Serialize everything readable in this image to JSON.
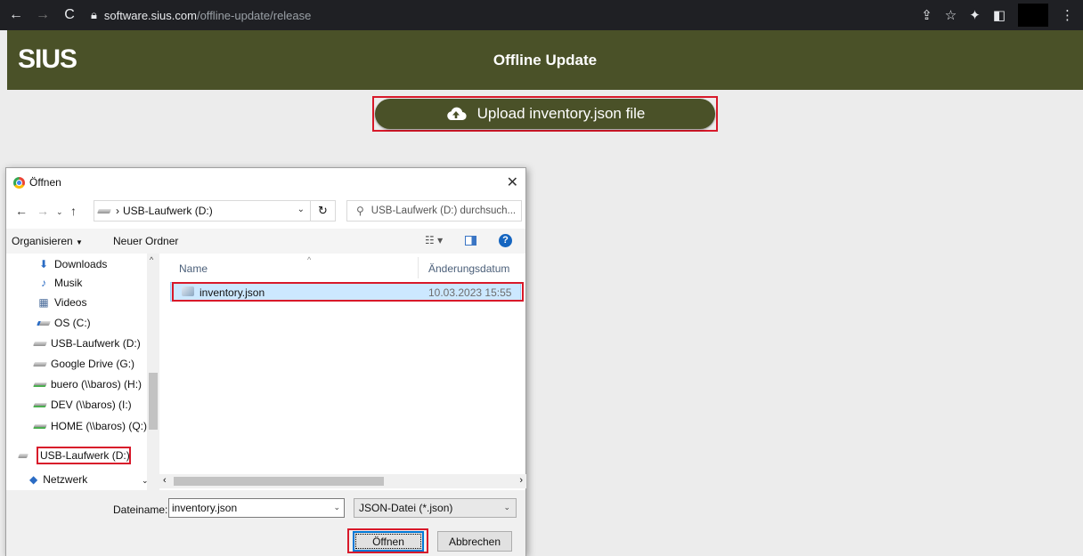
{
  "browser": {
    "back_icon": "arrow-left-icon",
    "url_host": "software.sius.com",
    "url_path": "/offline-update/release"
  },
  "app": {
    "logo": "SIUS",
    "title": "Offline Update",
    "upload_label": "Upload inventory.json file"
  },
  "dialog": {
    "title": "Öffnen",
    "address": "USB-Laufwerk (D:)",
    "search_placeholder": "USB-Laufwerk (D:) durchsuch...",
    "organize": "Organisieren",
    "new_folder": "Neuer Ordner",
    "nav_items": [
      {
        "label": "Downloads",
        "icon": "download-icon"
      },
      {
        "label": "Musik",
        "icon": "music-icon"
      },
      {
        "label": "Videos",
        "icon": "video-icon"
      },
      {
        "label": "OS (C:)",
        "icon": "drive-icon"
      },
      {
        "label": "USB-Laufwerk (D:)",
        "icon": "drive-icon"
      },
      {
        "label": "Google Drive (G:)",
        "icon": "drive-icon"
      },
      {
        "label": "buero (\\\\baros) (H:)",
        "icon": "network-drive-icon"
      },
      {
        "label": "DEV (\\\\baros) (I:)",
        "icon": "network-drive-icon"
      },
      {
        "label": "HOME (\\\\baros) (Q:)",
        "icon": "network-drive-icon"
      }
    ],
    "selected_nav": "USB-Laufwerk (D:)",
    "network": "Netzwerk",
    "columns": {
      "name": "Name",
      "date": "Änderungsdatum"
    },
    "files": [
      {
        "name": "inventory.json",
        "date": "10.03.2023 15:55"
      }
    ],
    "filename_label": "Dateiname:",
    "filename_value": "inventory.json",
    "filetype": "JSON-Datei (*.json)",
    "open_label": "Öffnen",
    "cancel_label": "Abbrechen"
  },
  "colors": {
    "brand": "#4a5128",
    "highlight": "#d8192a",
    "selection": "#cce8ff"
  }
}
